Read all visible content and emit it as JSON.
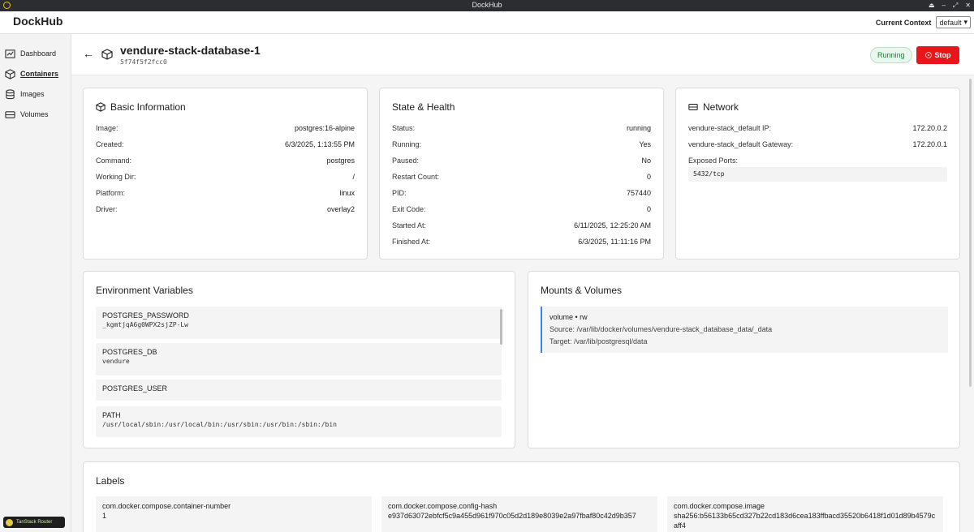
{
  "os": {
    "title": "DockHub"
  },
  "header": {
    "brand": "DockHub",
    "context_label": "Current Context",
    "context_value": "default"
  },
  "sidebar": {
    "items": [
      {
        "label": "Dashboard",
        "icon": "chart-icon"
      },
      {
        "label": "Containers",
        "icon": "box-icon",
        "active": true
      },
      {
        "label": "Images",
        "icon": "layers-icon"
      },
      {
        "label": "Volumes",
        "icon": "hard-drive-icon"
      }
    ],
    "router_badge": "TanStack Router"
  },
  "container": {
    "name": "vendure-stack-database-1",
    "id": "5f74f5f2fcc0",
    "status": "Running",
    "stop_label": "Stop"
  },
  "basic_info": {
    "title": "Basic Information",
    "rows": [
      {
        "key": "Image:",
        "value": "postgres:16-alpine"
      },
      {
        "key": "Created:",
        "value": "6/3/2025, 1:13:55 PM"
      },
      {
        "key": "Command:",
        "value": "postgres"
      },
      {
        "key": "Working Dir:",
        "value": "/"
      },
      {
        "key": "Platform:",
        "value": "linux"
      },
      {
        "key": "Driver:",
        "value": "overlay2"
      }
    ]
  },
  "state_health": {
    "title": "State & Health",
    "rows": [
      {
        "key": "Status:",
        "value": "running"
      },
      {
        "key": "Running:",
        "value": "Yes"
      },
      {
        "key": "Paused:",
        "value": "No"
      },
      {
        "key": "Restart Count:",
        "value": "0"
      },
      {
        "key": "PID:",
        "value": "757440"
      },
      {
        "key": "Exit Code:",
        "value": "0"
      },
      {
        "key": "Started At:",
        "value": "6/11/2025, 12:25:20 AM"
      },
      {
        "key": "Finished At:",
        "value": "6/3/2025, 11:11:16 PM"
      }
    ]
  },
  "network": {
    "title": "Network",
    "rows": [
      {
        "key": "vendure-stack_default IP:",
        "value": "172.20.0.2"
      },
      {
        "key": "vendure-stack_default Gateway:",
        "value": "172.20.0.1"
      }
    ],
    "exposed_label": "Exposed Ports:",
    "ports": "5432/tcp"
  },
  "env": {
    "title": "Environment Variables",
    "items": [
      {
        "name": "POSTGRES_PASSWORD",
        "value": "_kgmtjqA6g0WPX2sjZP-Lw"
      },
      {
        "name": "POSTGRES_DB",
        "value": "vendure"
      },
      {
        "name": "POSTGRES_USER",
        "value": ""
      },
      {
        "name": "PATH",
        "value": "/usr/local/sbin:/usr/local/bin:/usr/sbin:/usr/bin:/sbin:/bin"
      }
    ]
  },
  "mounts": {
    "title": "Mounts & Volumes",
    "items": [
      {
        "type": "volume • rw",
        "source": "Source: /var/lib/docker/volumes/vendure-stack_database_data/_data",
        "target": "Target: /var/lib/postgresql/data"
      }
    ]
  },
  "labels": {
    "title": "Labels",
    "items": [
      {
        "key": "com.docker.compose.container-number",
        "value": "1"
      },
      {
        "key": "com.docker.compose.config-hash",
        "value": "e937d63072ebfcf5c9a455d961f970c05d2d189e8039e2a97fbaf80c42d9b357"
      },
      {
        "key": "com.docker.compose.image",
        "value": "sha256:b56133b65cd327b22cd183d6cea183ffbacd35520b6418f1d01d89b4579caff4"
      }
    ]
  }
}
